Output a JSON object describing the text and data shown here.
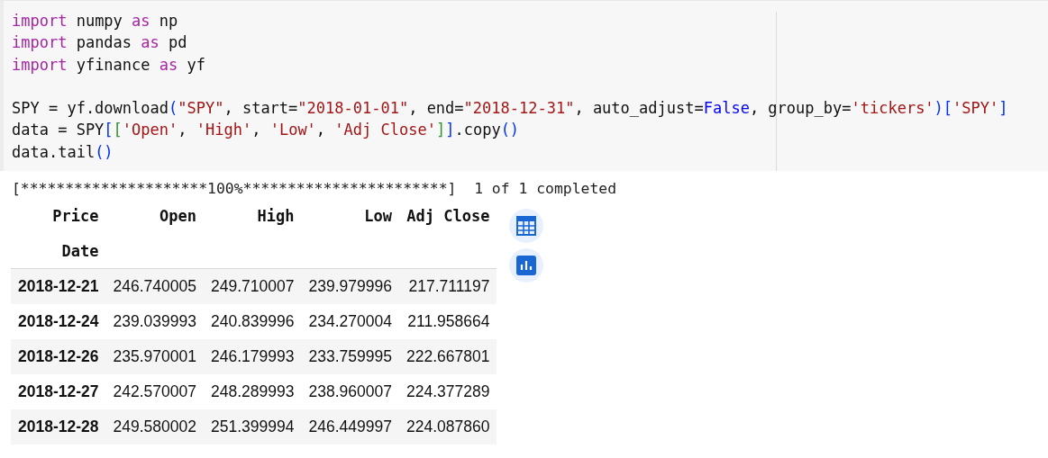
{
  "code_cell": {
    "lines": [
      [
        {
          "text": "import",
          "kind": "keyword"
        },
        {
          "text": " numpy ",
          "kind": "plain"
        },
        {
          "text": "as",
          "kind": "keyword"
        },
        {
          "text": " np",
          "kind": "plain"
        }
      ],
      [
        {
          "text": "import",
          "kind": "keyword"
        },
        {
          "text": " pandas ",
          "kind": "plain"
        },
        {
          "text": "as",
          "kind": "keyword"
        },
        {
          "text": " pd",
          "kind": "plain"
        }
      ],
      [
        {
          "text": "import",
          "kind": "keyword"
        },
        {
          "text": " yfinance ",
          "kind": "plain"
        },
        {
          "text": "as",
          "kind": "keyword"
        },
        {
          "text": " yf",
          "kind": "plain"
        }
      ],
      {
        "kind": "blank"
      },
      [
        {
          "text": "SPY = yf.download",
          "kind": "plain"
        },
        {
          "text": "(",
          "kind": "bracket"
        },
        {
          "text": "\"SPY\"",
          "kind": "string"
        },
        {
          "text": ", start=",
          "kind": "plain"
        },
        {
          "text": "\"2018-01-01\"",
          "kind": "string"
        },
        {
          "text": ", end=",
          "kind": "plain"
        },
        {
          "text": "\"2018-12-31\"",
          "kind": "string"
        },
        {
          "text": ", auto_adjust=",
          "kind": "plain"
        },
        {
          "text": "False",
          "kind": "constant"
        },
        {
          "text": ", group_by=",
          "kind": "plain"
        },
        {
          "text": "'tickers'",
          "kind": "string"
        },
        {
          "text": ")[",
          "kind": "bracket"
        },
        {
          "text": "'SPY'",
          "kind": "string"
        },
        {
          "text": "]",
          "kind": "bracket"
        }
      ],
      [
        {
          "text": "data = SPY",
          "kind": "plain"
        },
        {
          "text": "[",
          "kind": "bracket"
        },
        {
          "text": "[",
          "kind": "bracket2"
        },
        {
          "text": "'Open'",
          "kind": "string"
        },
        {
          "text": ", ",
          "kind": "plain"
        },
        {
          "text": "'High'",
          "kind": "string"
        },
        {
          "text": ", ",
          "kind": "plain"
        },
        {
          "text": "'Low'",
          "kind": "string"
        },
        {
          "text": ", ",
          "kind": "plain"
        },
        {
          "text": "'Adj Close'",
          "kind": "string"
        },
        {
          "text": "]",
          "kind": "bracket2"
        },
        {
          "text": "]",
          "kind": "bracket"
        },
        {
          "text": ".copy",
          "kind": "plain"
        },
        {
          "text": "()",
          "kind": "bracket"
        }
      ],
      [
        {
          "text": "data.tail",
          "kind": "plain"
        },
        {
          "text": "()",
          "kind": "bracket"
        }
      ]
    ]
  },
  "output": {
    "progress": "[*********************100%***********************]  1 of 1 completed",
    "table": {
      "columns": [
        "Price",
        "Open",
        "High",
        "Low",
        "Adj Close"
      ],
      "index_name": "Date",
      "rows": [
        [
          "2018-12-21",
          "246.740005",
          "249.710007",
          "239.979996",
          "217.711197"
        ],
        [
          "2018-12-24",
          "239.039993",
          "240.839996",
          "234.270004",
          "211.958664"
        ],
        [
          "2018-12-26",
          "235.970001",
          "246.179993",
          "233.759995",
          "222.667801"
        ],
        [
          "2018-12-27",
          "242.570007",
          "248.289993",
          "238.960007",
          "224.377289"
        ],
        [
          "2018-12-28",
          "249.580002",
          "251.399994",
          "246.449997",
          "224.087860"
        ]
      ]
    }
  }
}
